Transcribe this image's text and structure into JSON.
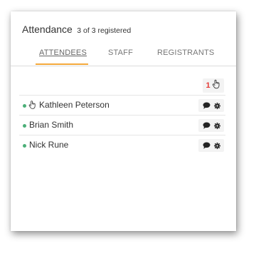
{
  "panel": {
    "title": "Attendance",
    "subtitle": "3 of 3 registered"
  },
  "tabs": [
    {
      "label": "ATTENDEES",
      "active": true
    },
    {
      "label": "STAFF",
      "active": false
    },
    {
      "label": "REGISTRANTS",
      "active": false
    }
  ],
  "toolbar": {
    "hand_raise_count": "1",
    "hand_icon": "hand-pointer-icon"
  },
  "attendees": [
    {
      "name": "Kathleen Peterson",
      "online": true,
      "hand_raised": true
    },
    {
      "name": "Brian Smith",
      "online": true,
      "hand_raised": false
    },
    {
      "name": "Nick Rune",
      "online": true,
      "hand_raised": false
    }
  ],
  "colors": {
    "accent": "#f4a93b",
    "online": "#4caf78",
    "count": "#e53935"
  }
}
